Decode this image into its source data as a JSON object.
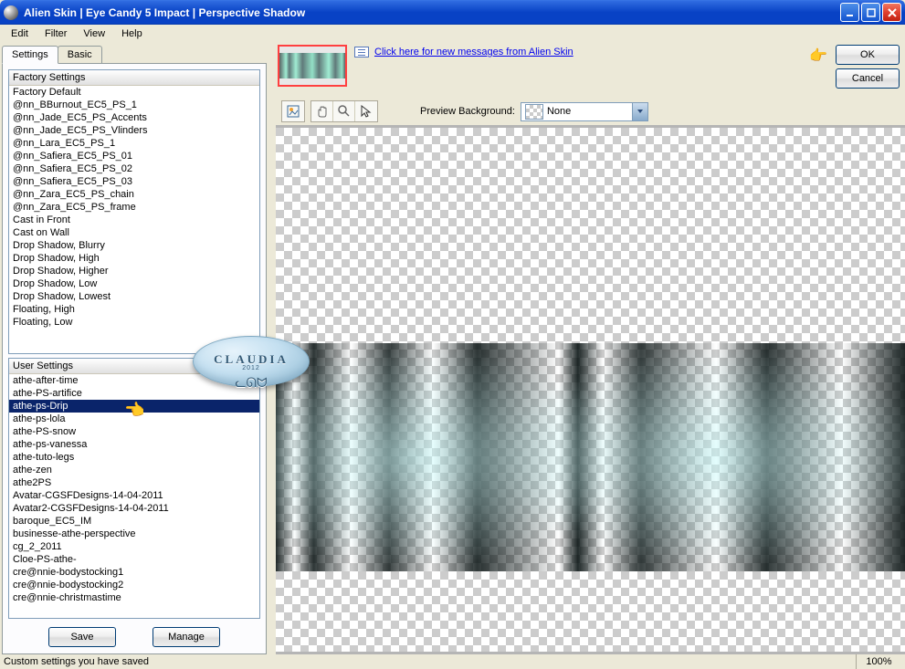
{
  "title": "Alien Skin  |  Eye Candy 5 Impact  |  Perspective Shadow",
  "menu": {
    "edit": "Edit",
    "filter": "Filter",
    "view": "View",
    "help": "Help"
  },
  "tabs": {
    "settings": "Settings",
    "basic": "Basic"
  },
  "factory": {
    "header": "Factory Settings",
    "items": [
      "Factory Default",
      "@nn_BBurnout_EC5_PS_1",
      "@nn_Jade_EC5_PS_Accents",
      "@nn_Jade_EC5_PS_Vlinders",
      "@nn_Lara_EC5_PS_1",
      "@nn_Safiera_EC5_PS_01",
      "@nn_Safiera_EC5_PS_02",
      "@nn_Safiera_EC5_PS_03",
      "@nn_Zara_EC5_PS_chain",
      "@nn_Zara_EC5_PS_frame",
      "Cast in Front",
      "Cast on Wall",
      "Drop Shadow, Blurry",
      "Drop Shadow, High",
      "Drop Shadow, Higher",
      "Drop Shadow, Low",
      "Drop Shadow, Lowest",
      "Floating, High",
      "Floating, Low"
    ]
  },
  "user": {
    "header": "User Settings",
    "selected": "athe-ps-Drip",
    "items": [
      "athe-after-time",
      "athe-PS-artifice",
      "athe-ps-Drip",
      "athe-ps-lola",
      "athe-PS-snow",
      "athe-ps-vanessa",
      "athe-tuto-legs",
      "athe-zen",
      "athe2PS",
      "Avatar-CGSFDesigns-14-04-2011",
      "Avatar2-CGSFDesigns-14-04-2011",
      "baroque_EC5_IM",
      "businesse-athe-perspective",
      "cg_2_2011",
      "Cloe-PS-athe-",
      "cre@nnie-bodystocking1",
      "cre@nnie-bodystocking2",
      "cre@nnie-christmastime"
    ]
  },
  "buttons": {
    "save": "Save",
    "manage": "Manage",
    "ok": "OK",
    "cancel": "Cancel"
  },
  "msglink": "Click here for new messages from Alien Skin",
  "previewbg_label": "Preview Background:",
  "previewbg_value": "None",
  "status": "Custom settings you have saved",
  "zoom": "100%",
  "watermark": {
    "text": "CLAUDIA",
    "year": "2012"
  }
}
